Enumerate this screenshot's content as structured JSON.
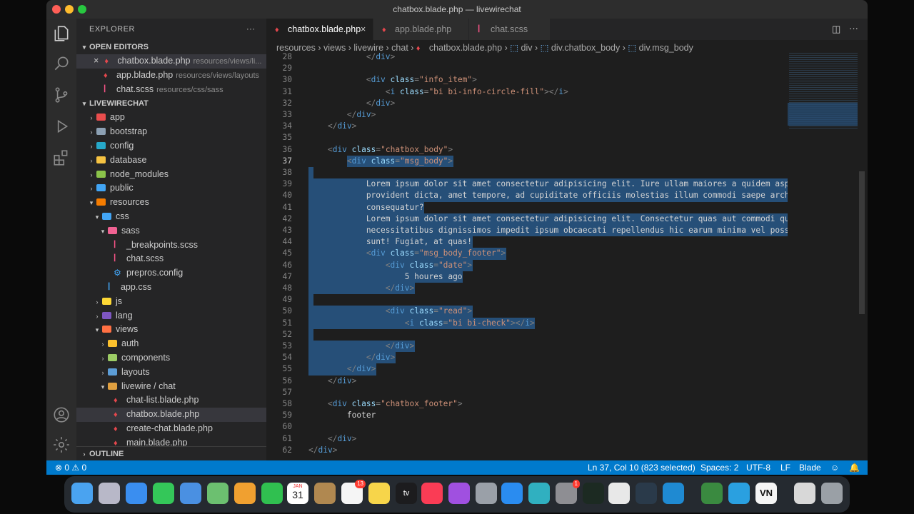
{
  "window": {
    "title": "chatbox.blade.php — livewirechat"
  },
  "sidebar": {
    "header": "EXPLORER",
    "open_editors_label": "OPEN EDITORS",
    "open_editors": [
      {
        "name": "chatbox.blade.php",
        "path": "resources/views/li..."
      },
      {
        "name": "app.blade.php",
        "path": "resources/views/layouts"
      },
      {
        "name": "chat.scss",
        "path": "resources/css/sass"
      }
    ],
    "project_label": "LIVEWIRECHAT",
    "tree": [
      {
        "label": "app"
      },
      {
        "label": "bootstrap"
      },
      {
        "label": "config"
      },
      {
        "label": "database"
      },
      {
        "label": "node_modules"
      },
      {
        "label": "public"
      },
      {
        "label": "resources"
      },
      {
        "label": "css"
      },
      {
        "label": "sass"
      },
      {
        "label": "_breakpoints.scss"
      },
      {
        "label": "chat.scss"
      },
      {
        "label": "prepros.config"
      },
      {
        "label": "app.css"
      },
      {
        "label": "js"
      },
      {
        "label": "lang"
      },
      {
        "label": "views"
      },
      {
        "label": "auth"
      },
      {
        "label": "components"
      },
      {
        "label": "layouts"
      },
      {
        "label": "livewire / chat"
      },
      {
        "label": "chat-list.blade.php"
      },
      {
        "label": "chatbox.blade.php"
      },
      {
        "label": "create-chat.blade.php"
      },
      {
        "label": "main.blade.php"
      }
    ],
    "outline_label": "OUTLINE"
  },
  "tabs": [
    {
      "label": "chatbox.blade.php",
      "close": "×"
    },
    {
      "label": "app.blade.php"
    },
    {
      "label": "chat.scss"
    }
  ],
  "breadcrumb": [
    "resources",
    "views",
    "livewire",
    "chat",
    "chatbox.blade.php",
    "div",
    "div.chatbox_body",
    "div.msg_body"
  ],
  "editor": {
    "lines": [
      {
        "n": "28",
        "t": "            </div>"
      },
      {
        "n": "29",
        "t": ""
      },
      {
        "n": "30",
        "t": "            <div class=\"info_item\">"
      },
      {
        "n": "31",
        "t": "                <i class=\"bi bi-info-circle-fill\"></i>"
      },
      {
        "n": "32",
        "t": "            </div>"
      },
      {
        "n": "33",
        "t": "        </div>"
      },
      {
        "n": "34",
        "t": "    </div>"
      },
      {
        "n": "35",
        "t": ""
      },
      {
        "n": "36",
        "t": "    <div class=\"chatbox_body\">"
      },
      {
        "n": "37",
        "t": "        <div class=\"msg_body\">"
      },
      {
        "n": "38",
        "t": ""
      },
      {
        "n": "39",
        "t": "            Lorem ipsum dolor sit amet consectetur adipisicing elit. Iure ullam maiores a quidem asperna"
      },
      {
        "n": "40",
        "t": "            provident dicta, amet tempore, ad cupiditate officiis molestias illum commodi saepe architec"
      },
      {
        "n": "41",
        "t": "            consequatur?"
      },
      {
        "n": "42",
        "t": "            Lorem ipsum dolor sit amet consectetur adipisicing elit. Consectetur quas aut commodi quo,"
      },
      {
        "n": "43",
        "t": "            necessitatibus dignissimos impedit ipsum obcaecati repellendus hic earum minima vel possimus"
      },
      {
        "n": "44",
        "t": "            sunt! Fugiat, at quas!"
      },
      {
        "n": "45",
        "t": "            <div class=\"msg_body_footer\">"
      },
      {
        "n": "46",
        "t": "                <div class=\"date\">"
      },
      {
        "n": "47",
        "t": "                    5 houres ago"
      },
      {
        "n": "48",
        "t": "                </div>"
      },
      {
        "n": "49",
        "t": ""
      },
      {
        "n": "50",
        "t": "                <div class=\"read\">"
      },
      {
        "n": "51",
        "t": "                    <i class=\"bi bi-check\"></i>"
      },
      {
        "n": "52",
        "t": ""
      },
      {
        "n": "53",
        "t": "                </div>"
      },
      {
        "n": "54",
        "t": "            </div>"
      },
      {
        "n": "55",
        "t": "        </div>"
      },
      {
        "n": "56",
        "t": "    </div>"
      },
      {
        "n": "57",
        "t": ""
      },
      {
        "n": "58",
        "t": "    <div class=\"chatbox_footer\">"
      },
      {
        "n": "59",
        "t": "        footer"
      },
      {
        "n": "60",
        "t": ""
      },
      {
        "n": "61",
        "t": "    </div>"
      },
      {
        "n": "62",
        "t": "</div>"
      }
    ],
    "selected_from_line": "37",
    "selected_to_line": "55"
  },
  "statusbar": {
    "problems": "⊗ 0 ⚠ 0",
    "position": "Ln 37, Col 10 (823 selected)",
    "spaces": "Spaces: 2",
    "encoding": "UTF-8",
    "eol": "LF",
    "language": "Blade"
  },
  "dock": {
    "calendar_month": "JAN",
    "calendar_day": "31",
    "tv_label": "tv",
    "vn_label": "VN",
    "reminders_badge": "13",
    "badge_one": "1"
  },
  "colors": {
    "accent": "#007acc",
    "selection": "#264f78",
    "blade_icon": "#e5474d",
    "scss_icon": "#f55385"
  }
}
